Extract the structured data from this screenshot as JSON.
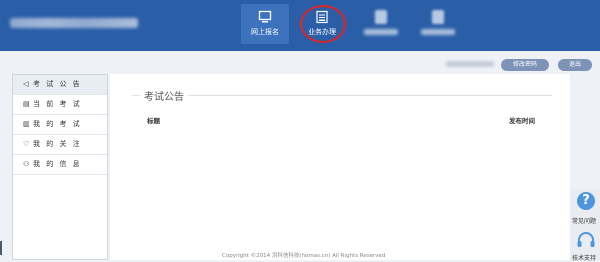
{
  "header": {
    "nav": [
      {
        "label": "网上报名",
        "icon": "monitor-icon",
        "active": true
      },
      {
        "label": "业务办理",
        "icon": "document-icon",
        "active": false
      }
    ]
  },
  "actions": {
    "edit_password": "修改密码",
    "logout": "退出"
  },
  "sidebar": {
    "items": [
      {
        "label": "考 试 公 告",
        "icon": "megaphone-icon",
        "glyph": "◁",
        "active": true
      },
      {
        "label": "当 前 考 试",
        "icon": "clipboard-icon",
        "glyph": "▤",
        "active": false
      },
      {
        "label": "我 的 考 试",
        "icon": "list-icon",
        "glyph": "▥",
        "active": false
      },
      {
        "label": "我 的 关 注",
        "icon": "heart-icon",
        "glyph": "♡",
        "active": false
      },
      {
        "label": "我 的 信 息",
        "icon": "user-icon",
        "glyph": "⚇",
        "active": false
      }
    ]
  },
  "main": {
    "section_title": "考试公告",
    "columns": {
      "title": "标题",
      "date": "发布时间"
    }
  },
  "footer": {
    "copyright": "Copyright ©2014 洪科信科技(homas.cn) All Rights Reserved"
  },
  "float": {
    "faq": "常见问题",
    "faq_glyph": "?",
    "support": "技术支持"
  },
  "colors": {
    "header_bg": "#2a5fa8",
    "active_tab_bg": "#3d73bd",
    "highlight_circle": "#e02323",
    "pill_bg": "#7d93b8",
    "help_blue": "#4d96dd"
  }
}
